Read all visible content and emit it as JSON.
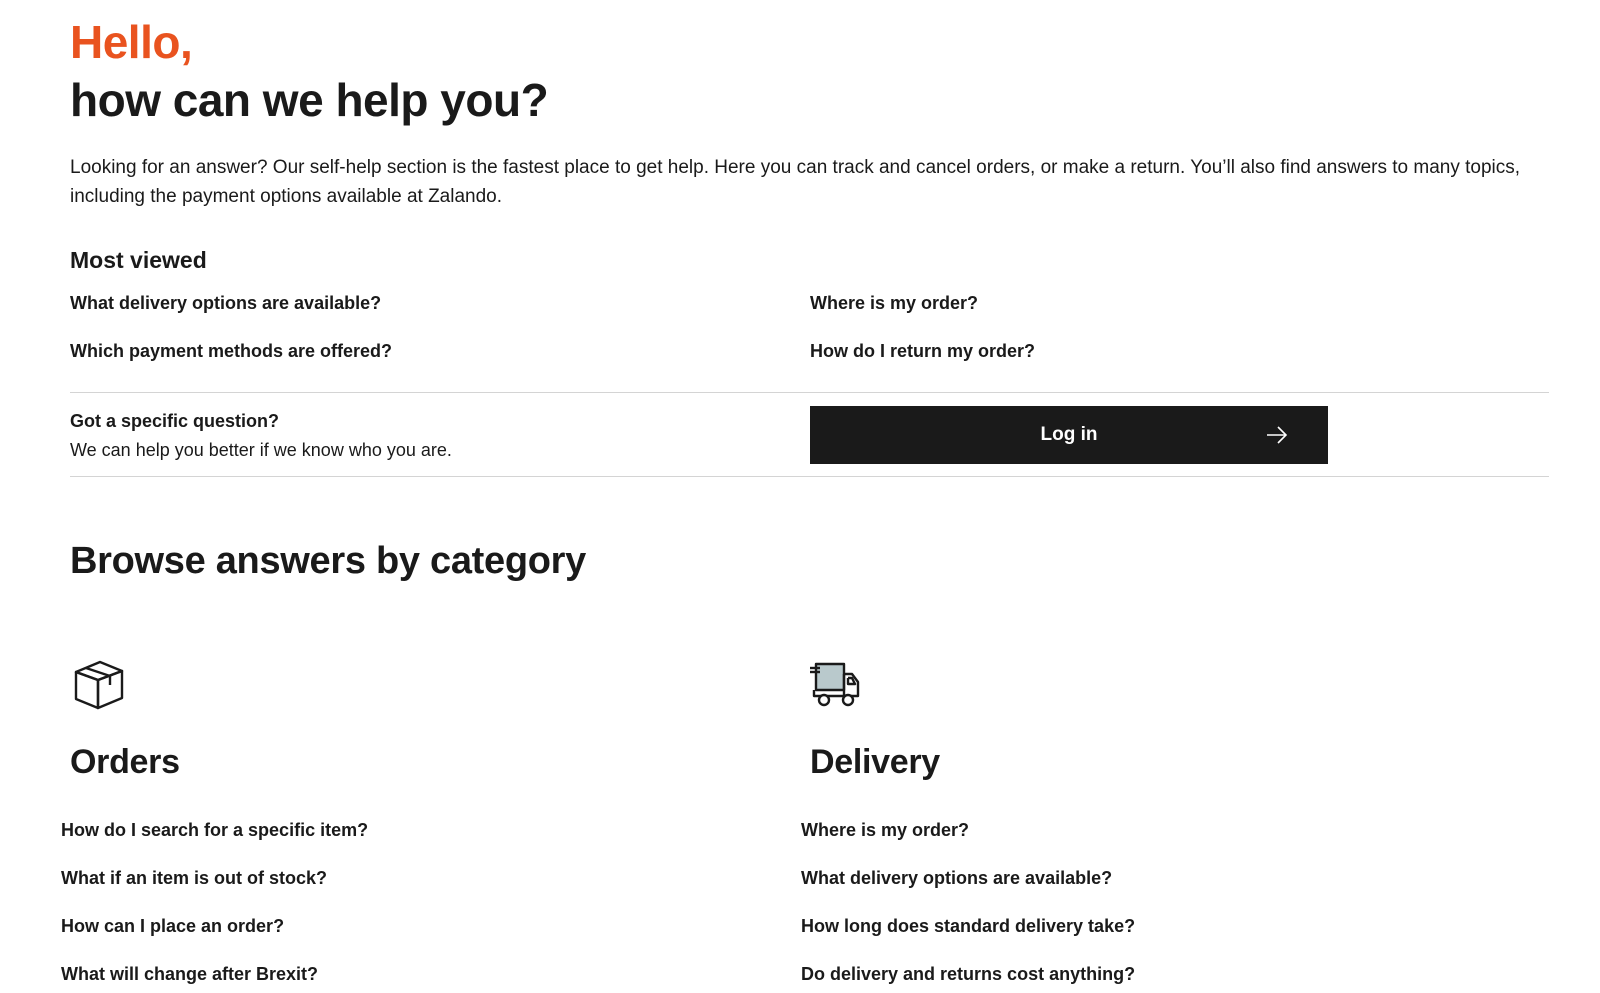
{
  "header": {
    "greeting": "Hello,",
    "greeting_color": "#e9531f",
    "headline": "how can we help you?",
    "intro": "Looking for an answer? Our self-help section is the fastest place to get help. Here you can track and cancel orders, or make a return. You’ll also find answers to many topics, including the payment options available at Zalando."
  },
  "most_viewed": {
    "title": "Most viewed",
    "links": [
      "What delivery options are available?",
      "Where is my order?",
      "Which payment methods are offered?",
      "How do I return my order?"
    ]
  },
  "login_prompt": {
    "title": "Got a specific question?",
    "subtitle": "We can help you better if we know who you are.",
    "button_label": "Log in",
    "button_icon": "arrow-right-icon"
  },
  "browse": {
    "title": "Browse answers by category",
    "categories": [
      {
        "name": "Orders",
        "icon": "package-box-icon",
        "links": [
          "How do I search for a specific item?",
          "What if an item is out of stock?",
          "How can I place an order?",
          "What will change after Brexit?"
        ]
      },
      {
        "name": "Delivery",
        "icon": "delivery-truck-icon",
        "links": [
          "Where is my order?",
          "What delivery options are available?",
          "How long does standard delivery take?",
          "Do delivery and returns cost anything?"
        ]
      }
    ]
  }
}
